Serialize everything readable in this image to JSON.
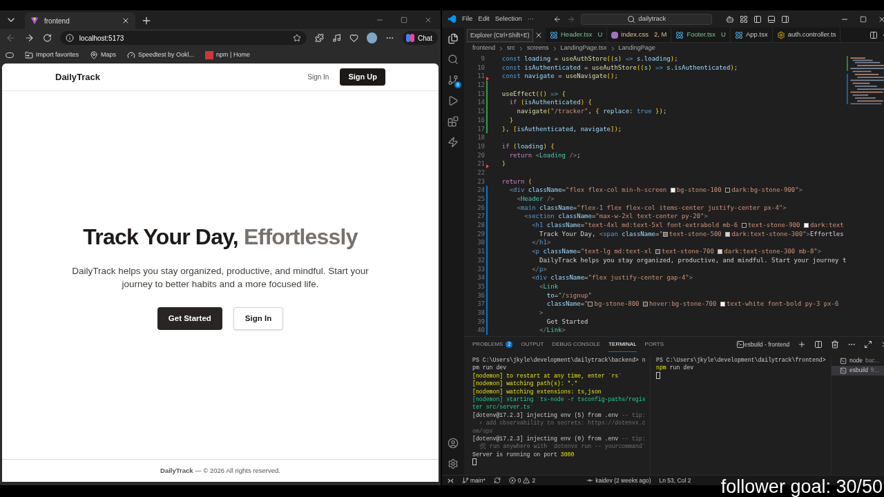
{
  "browser": {
    "tab": {
      "title": "frontend"
    },
    "address": "localhost:5173",
    "chat_button": "Chat",
    "bookmarks": [
      "Import favorites",
      "Maps",
      "Speedtest by Ookl...",
      "npm | Home"
    ],
    "page": {
      "brand": "DailyTrack",
      "nav": [
        {
          "label": "Sign In",
          "kind": "link"
        },
        {
          "label": "Sign Up",
          "kind": "primary"
        }
      ],
      "hero": {
        "title": "Track Your Day, ",
        "title_accent": "Effortlessly",
        "text": "DailyTrack helps you stay organized, productive, and mindful. Start your journey to better habits and a more focused life.",
        "buttons": [
          {
            "label": "Get Started",
            "kind": "primary"
          },
          {
            "label": "Sign In",
            "kind": "outline"
          }
        ]
      },
      "footer": "**DailyTrack** — © 2026 All rights reserved."
    }
  },
  "editor": {
    "menu": [
      "File",
      "Edit",
      "Selection",
      "···"
    ],
    "search": "dailytrack",
    "source_control_badge": "8",
    "tooltip": "Explorer (Ctrl+Shift+E)",
    "tabs": [
      {
        "name": "Header.tsx",
        "status": "U",
        "kind": "react"
      },
      {
        "name": "index.css",
        "status": "2, M",
        "kind": "css"
      },
      {
        "name": "Footer.tsx",
        "status": "U",
        "kind": "react"
      },
      {
        "name": "App.tsx",
        "kind": "react"
      },
      {
        "name": "auth.controller.ts",
        "kind": "gear"
      }
    ],
    "breadcrumb": [
      "frontend",
      "src",
      "screens",
      "LandingPage.tsx",
      "LandingPage"
    ],
    "lines": [
      {
        "number": "9",
        "tokens": [
          {
            "kind": "k",
            "text": "  const"
          },
          {
            "kind": "v",
            "text": " loading"
          },
          {
            "kind": "p",
            "text": " = "
          },
          {
            "kind": "f",
            "text": "useAuthStore"
          },
          {
            "kind": "b",
            "text": "(("
          },
          {
            "kind": "v",
            "text": "s"
          },
          {
            "kind": "b",
            "text": ")"
          },
          {
            "kind": "k",
            "text": " =>"
          },
          {
            "kind": "v",
            "text": " s.loading"
          },
          {
            "kind": "b",
            "text": ")"
          },
          {
            "kind": "p",
            "text": ";"
          }
        ]
      },
      {
        "number": "10",
        "tokens": [
          {
            "kind": "k",
            "text": "  const"
          },
          {
            "kind": "v",
            "text": " isAuthenticated"
          },
          {
            "kind": "p",
            "text": " = "
          },
          {
            "kind": "f",
            "text": "useAuthStore"
          },
          {
            "kind": "b",
            "text": "(("
          },
          {
            "kind": "v",
            "text": "s"
          },
          {
            "kind": "b",
            "text": ")"
          },
          {
            "kind": "k",
            "text": " =>"
          },
          {
            "kind": "v",
            "text": " s.isAuthenticated"
          },
          {
            "kind": "b",
            "text": ")"
          },
          {
            "kind": "p",
            "text": ";"
          }
        ]
      },
      {
        "number": "11",
        "color": "#f14c4c",
        "tokens": [
          {
            "kind": "k",
            "text": "  const"
          },
          {
            "kind": "v",
            "text": " navigate"
          },
          {
            "kind": "p",
            "text": " = "
          },
          {
            "kind": "f",
            "text": "useNavigate"
          },
          {
            "kind": "b",
            "text": "()"
          },
          {
            "kind": "p",
            "text": ";"
          }
        ]
      },
      {
        "number": "12",
        "color": "#2ea043"
      },
      {
        "number": "13",
        "color": "#2ea043",
        "tokens": [
          {
            "kind": "f",
            "text": "  useEffect"
          },
          {
            "kind": "b",
            "text": "(()"
          },
          {
            "kind": "k",
            "text": " =>"
          },
          {
            "kind": "b",
            "text": " {"
          }
        ]
      },
      {
        "number": "14",
        "color": "#2ea043",
        "tokens": [
          {
            "kind": "c",
            "text": "    if"
          },
          {
            "kind": "b",
            "text": " ("
          },
          {
            "kind": "v",
            "text": "isAuthenticated"
          },
          {
            "kind": "b",
            "text": ") {"
          }
        ]
      },
      {
        "number": "15",
        "color": "#2ea043",
        "tokens": [
          {
            "kind": "f",
            "text": "      navigate"
          },
          {
            "kind": "b",
            "text": "("
          },
          {
            "kind": "s",
            "text": "\"/tracker\""
          },
          {
            "kind": "p",
            "text": ", "
          },
          {
            "kind": "b",
            "text": "{ "
          },
          {
            "kind": "v",
            "text": "replace"
          },
          {
            "kind": "p",
            "text": ": "
          },
          {
            "kind": "k",
            "text": "true"
          },
          {
            "kind": "b",
            "text": " })"
          },
          {
            "kind": "p",
            "text": ";"
          }
        ]
      },
      {
        "number": "16",
        "color": "#2ea043",
        "tokens": [
          {
            "kind": "b",
            "text": "    }"
          }
        ]
      },
      {
        "number": "17",
        "color": "#2ea043",
        "tokens": [
          {
            "kind": "b",
            "text": "  }"
          },
          {
            "kind": "p",
            "text": ", "
          },
          {
            "kind": "b",
            "text": "["
          },
          {
            "kind": "v",
            "text": "isAuthenticated"
          },
          {
            "kind": "p",
            "text": ", "
          },
          {
            "kind": "v",
            "text": "navigate"
          },
          {
            "kind": "b",
            "text": "])"
          },
          {
            "kind": "p",
            "text": ";"
          }
        ]
      },
      {
        "number": "18"
      },
      {
        "number": "19",
        "tokens": [
          {
            "kind": "c",
            "text": "  if"
          },
          {
            "kind": "b",
            "text": " ("
          },
          {
            "kind": "v",
            "text": "loading"
          },
          {
            "kind": "b",
            "text": ") {"
          }
        ]
      },
      {
        "number": "20",
        "tokens": [
          {
            "kind": "c",
            "text": "    return"
          },
          {
            "kind": "g",
            "text": " <"
          },
          {
            "kind": "t",
            "text": "Loading"
          },
          {
            "kind": "g",
            "text": " />"
          },
          {
            "kind": "p",
            "text": ";"
          }
        ]
      },
      {
        "number": "21",
        "color": "#f14c4c",
        "tokens": [
          {
            "kind": "b",
            "text": "  }"
          }
        ]
      },
      {
        "number": "22"
      },
      {
        "number": "23",
        "tokens": [
          {
            "kind": "c",
            "text": "  return"
          },
          {
            "kind": "b",
            "text": " ("
          }
        ]
      },
      {
        "number": "24",
        "color": "#0078d4",
        "tokens": [
          {
            "kind": "g",
            "text": "    <"
          },
          {
            "kind": "h",
            "text": "div"
          },
          {
            "kind": "v",
            "text": " className"
          },
          {
            "kind": "p",
            "text": "="
          },
          {
            "kind": "s",
            "text": "\"flex flex-col min-h-screen "
          },
          {
            "kind": "swatch",
            "color": "#f5f5f4"
          },
          {
            "kind": "s",
            "text": "bg-stone-100 "
          },
          {
            "kind": "swatch",
            "color": "#1c1917"
          },
          {
            "kind": "s",
            "text": "dark:bg-stone-900\""
          },
          {
            "kind": "g",
            "text": ">"
          }
        ]
      },
      {
        "number": "25",
        "color": "#0078d4",
        "tokens": [
          {
            "kind": "g",
            "text": "      <"
          },
          {
            "kind": "t",
            "text": "Header"
          },
          {
            "kind": "g",
            "text": " />"
          }
        ]
      },
      {
        "number": "26",
        "color": "#0078d4",
        "tokens": [
          {
            "kind": "g",
            "text": "      <"
          },
          {
            "kind": "h",
            "text": "main"
          },
          {
            "kind": "v",
            "text": " className"
          },
          {
            "kind": "p",
            "text": "="
          },
          {
            "kind": "s",
            "text": "\"flex-1 flex flex-col items-center justify-center px-4\""
          },
          {
            "kind": "g",
            "text": ">"
          }
        ]
      },
      {
        "number": "27",
        "color": "#0078d4",
        "tokens": [
          {
            "kind": "g",
            "text": "        <"
          },
          {
            "kind": "h",
            "text": "section"
          },
          {
            "kind": "v",
            "text": " className"
          },
          {
            "kind": "p",
            "text": "="
          },
          {
            "kind": "s",
            "text": "\"max-w-2xl text-center py-20\""
          },
          {
            "kind": "g",
            "text": ">"
          }
        ]
      },
      {
        "number": "28",
        "color": "#0078d4",
        "tokens": [
          {
            "kind": "g",
            "text": "          <"
          },
          {
            "kind": "h",
            "text": "h1"
          },
          {
            "kind": "v",
            "text": " className"
          },
          {
            "kind": "p",
            "text": "="
          },
          {
            "kind": "s",
            "text": "\"text-4xl md:text-5xl font-extrabold mb-6 "
          },
          {
            "kind": "swatch",
            "color": "#1c1917"
          },
          {
            "kind": "s",
            "text": "text-stone-900 "
          },
          {
            "kind": "swatch",
            "color": "#fafaf9"
          },
          {
            "kind": "s",
            "text": "dark:text"
          }
        ]
      },
      {
        "number": "29",
        "color": "#0078d4",
        "tokens": [
          {
            "kind": "p",
            "text": "            Track Your Day, "
          },
          {
            "kind": "g",
            "text": "<"
          },
          {
            "kind": "h",
            "text": "span"
          },
          {
            "kind": "v",
            "text": " className"
          },
          {
            "kind": "p",
            "text": "="
          },
          {
            "kind": "s",
            "text": "\""
          },
          {
            "kind": "swatch",
            "color": "#78716c"
          },
          {
            "kind": "s",
            "text": "text-stone-500 "
          },
          {
            "kind": "swatch",
            "color": "#d6d3d1"
          },
          {
            "kind": "s",
            "text": "dark:text-stone-300\""
          },
          {
            "kind": "g",
            "text": ">"
          },
          {
            "kind": "p",
            "text": "Effortles"
          }
        ]
      },
      {
        "number": "30",
        "color": "#0078d4",
        "tokens": [
          {
            "kind": "g",
            "text": "          </"
          },
          {
            "kind": "h",
            "text": "h1"
          },
          {
            "kind": "g",
            "text": ">"
          }
        ]
      },
      {
        "number": "31",
        "color": "#0078d4",
        "tokens": [
          {
            "kind": "g",
            "text": "          <"
          },
          {
            "kind": "h",
            "text": "p"
          },
          {
            "kind": "v",
            "text": " className"
          },
          {
            "kind": "p",
            "text": "="
          },
          {
            "kind": "s",
            "text": "\"text-lg md:text-xl "
          },
          {
            "kind": "swatch",
            "color": "#44403c"
          },
          {
            "kind": "s",
            "text": "text-stone-700 "
          },
          {
            "kind": "swatch",
            "color": "#d6d3d1"
          },
          {
            "kind": "s",
            "text": "dark:text-stone-300 mb-8\""
          },
          {
            "kind": "g",
            "text": ">"
          }
        ]
      },
      {
        "number": "32",
        "color": "#0078d4",
        "tokens": [
          {
            "kind": "p",
            "text": "            DailyTrack helps you stay organized, productive, and mindful. Start your journey t"
          }
        ]
      },
      {
        "number": "33",
        "color": "#0078d4",
        "tokens": [
          {
            "kind": "g",
            "text": "          </"
          },
          {
            "kind": "h",
            "text": "p"
          },
          {
            "kind": "g",
            "text": ">"
          }
        ]
      },
      {
        "number": "34",
        "color": "#0078d4",
        "tokens": [
          {
            "kind": "g",
            "text": "          <"
          },
          {
            "kind": "h",
            "text": "div"
          },
          {
            "kind": "v",
            "text": " className"
          },
          {
            "kind": "p",
            "text": "="
          },
          {
            "kind": "s",
            "text": "\"flex justify-center gap-4\""
          },
          {
            "kind": "g",
            "text": ">"
          }
        ]
      },
      {
        "number": "35",
        "color": "#0078d4",
        "tokens": [
          {
            "kind": "g",
            "text": "            <"
          },
          {
            "kind": "t",
            "text": "Link"
          }
        ]
      },
      {
        "number": "36",
        "color": "#0078d4",
        "tokens": [
          {
            "kind": "v",
            "text": "              to"
          },
          {
            "kind": "p",
            "text": "="
          },
          {
            "kind": "s",
            "text": "\"/signup\""
          }
        ]
      },
      {
        "number": "37",
        "color": "#0078d4",
        "tokens": [
          {
            "kind": "v",
            "text": "              className"
          },
          {
            "kind": "p",
            "text": "="
          },
          {
            "kind": "s",
            "text": "\""
          },
          {
            "kind": "swatch",
            "color": "#292524"
          },
          {
            "kind": "s",
            "text": "bg-stone-800 "
          },
          {
            "kind": "swatch",
            "color": "#44403c"
          },
          {
            "kind": "s",
            "text": "hover:bg-stone-700 "
          },
          {
            "kind": "swatch",
            "color": "#ffffff"
          },
          {
            "kind": "s",
            "text": "text-white font-bold py-3 px-6"
          }
        ]
      },
      {
        "number": "38",
        "color": "#0078d4",
        "tokens": [
          {
            "kind": "g",
            "text": "            >"
          }
        ]
      },
      {
        "number": "39",
        "color": "#0078d4",
        "tokens": [
          {
            "kind": "p",
            "text": "              Get Started"
          }
        ]
      },
      {
        "number": "40",
        "color": "#0078d4",
        "tokens": [
          {
            "kind": "g",
            "text": "            </"
          },
          {
            "kind": "t",
            "text": "Link"
          },
          {
            "kind": "g",
            "text": ">"
          }
        ]
      }
    ],
    "panel_tabs": [
      {
        "label": "PROBLEMS",
        "badge": "2",
        "selected": false
      },
      {
        "label": "OUTPUT",
        "selected": false
      },
      {
        "label": "DEBUG CONSOLE",
        "selected": false
      },
      {
        "label": "TERMINAL",
        "selected": true
      },
      {
        "label": "PORTS",
        "selected": false
      }
    ],
    "terminal_title": "esbuild - frontend",
    "terminal_left": [
      [
        {
          "kind": "w",
          "text": "PS C:\\Users\\jkyle\\development\\dailytrack\\backend> n"
        }
      ],
      [
        {
          "kind": "w",
          "text": "pm run dev"
        }
      ],
      [
        {
          "kind": "y",
          "text": "[nodemon] to restart at any time, enter `rs`"
        }
      ],
      [
        {
          "kind": "y",
          "text": "[nodemon] watching path(s): *.*"
        }
      ],
      [
        {
          "kind": "y",
          "text": "[nodemon] watching extensions: ts,json"
        }
      ],
      [
        {
          "kind": "gr",
          "text": "[nodemon] starting `ts-node -r tsconfig-paths/regis"
        }
      ],
      [
        {
          "kind": "gr",
          "text": "ter src/server.ts`"
        }
      ],
      [
        {
          "kind": "w",
          "text": "[dotenv@17.2.3] injecting env (5) from .env"
        },
        {
          "kind": "d",
          "text": " -- tip:"
        }
      ],
      [
        {
          "kind": "d",
          "text": "  ⚡ add observability to secrets: https://dotenvx.c"
        }
      ],
      [
        {
          "kind": "d",
          "text": "om/ops"
        }
      ],
      [
        {
          "kind": "w",
          "text": "[dotenv@17.2.3] injecting env (0) from .env"
        },
        {
          "kind": "d",
          "text": " -- tip:"
        }
      ],
      [
        {
          "kind": "d",
          "text": "  🛠 run anywhere with `dotenvx run -- yourcommand`"
        }
      ],
      [
        {
          "kind": "w",
          "text": "Server is running on port "
        },
        {
          "kind": "y",
          "text": "3000"
        }
      ]
    ],
    "terminal_right": [
      [
        {
          "kind": "w",
          "text": "PS C:\\Users\\jkyle\\development\\dailytrack\\frontend>"
        }
      ],
      [
        {
          "kind": "y",
          "text": "npm"
        },
        {
          "kind": "w",
          "text": " run dev"
        }
      ]
    ],
    "terminals": [
      {
        "name": "node",
        "hint": "bac...",
        "selected": false
      },
      {
        "name": "esbuild",
        "hint": "fr...",
        "selected": true
      }
    ],
    "status": {
      "branch": "main*",
      "errors": "0",
      "warnings": "2",
      "blame": "kaidev (2 weeks ago)",
      "position": "Ln 53, Col 2"
    }
  },
  "overlay": "follower goal: 30/50"
}
